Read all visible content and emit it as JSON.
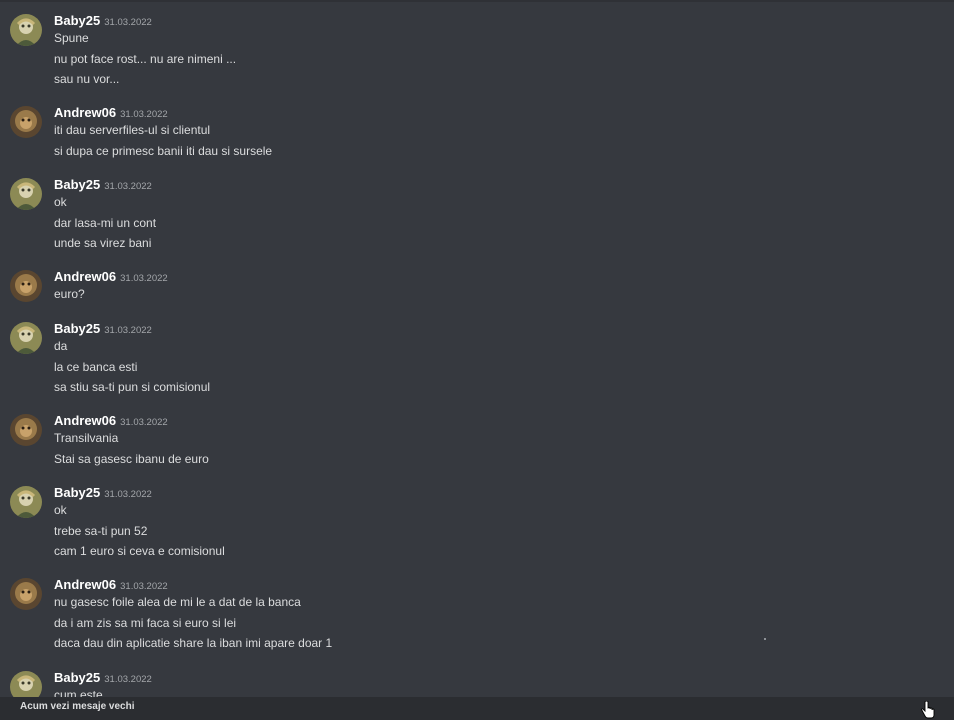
{
  "groups": [
    {
      "author": "Baby25",
      "time": "31.03.2022",
      "avatar": "baby25-avatar",
      "lines": [
        "Spune",
        "nu pot face rost... nu are nimeni ...",
        "sau nu vor..."
      ]
    },
    {
      "author": "Andrew06",
      "time": "31.03.2022",
      "avatar": "andrew06-avatar",
      "lines": [
        "iti dau serverfiles-ul si clientul",
        "si dupa ce primesc banii iti dau si sursele"
      ]
    },
    {
      "author": "Baby25",
      "time": "31.03.2022",
      "avatar": "baby25-avatar",
      "lines": [
        "ok",
        "dar lasa-mi un cont",
        "unde sa virez bani"
      ]
    },
    {
      "author": "Andrew06",
      "time": "31.03.2022",
      "avatar": "andrew06-avatar",
      "lines": [
        "euro?"
      ]
    },
    {
      "author": "Baby25",
      "time": "31.03.2022",
      "avatar": "baby25-avatar",
      "lines": [
        "da",
        "la ce banca esti",
        "sa stiu sa-ti pun si comisionul"
      ]
    },
    {
      "author": "Andrew06",
      "time": "31.03.2022",
      "avatar": "andrew06-avatar",
      "lines": [
        "Transilvania",
        "Stai sa gasesc ibanu de euro"
      ]
    },
    {
      "author": "Baby25",
      "time": "31.03.2022",
      "avatar": "baby25-avatar",
      "lines": [
        "ok",
        "trebe sa-ti pun 52",
        "cam 1 euro si ceva e comisionul"
      ]
    },
    {
      "author": "Andrew06",
      "time": "31.03.2022",
      "avatar": "andrew06-avatar",
      "lines": [
        "nu gasesc foile alea de mi le a dat de la banca",
        "da i am zis sa mi faca si euro si lei",
        "daca dau din aplicatie share la iban imi apare doar 1"
      ]
    },
    {
      "author": "Baby25",
      "time": "31.03.2022",
      "avatar": "baby25-avatar",
      "lines": [
        "cum este"
      ]
    }
  ],
  "footer": {
    "label": "Acum vezi mesaje vechi"
  },
  "colors": {
    "background": "#36393f",
    "bar": "#2b2d31",
    "username": "#ffffff",
    "text": "#dcddde",
    "timestamp": "#a3a6aa"
  }
}
